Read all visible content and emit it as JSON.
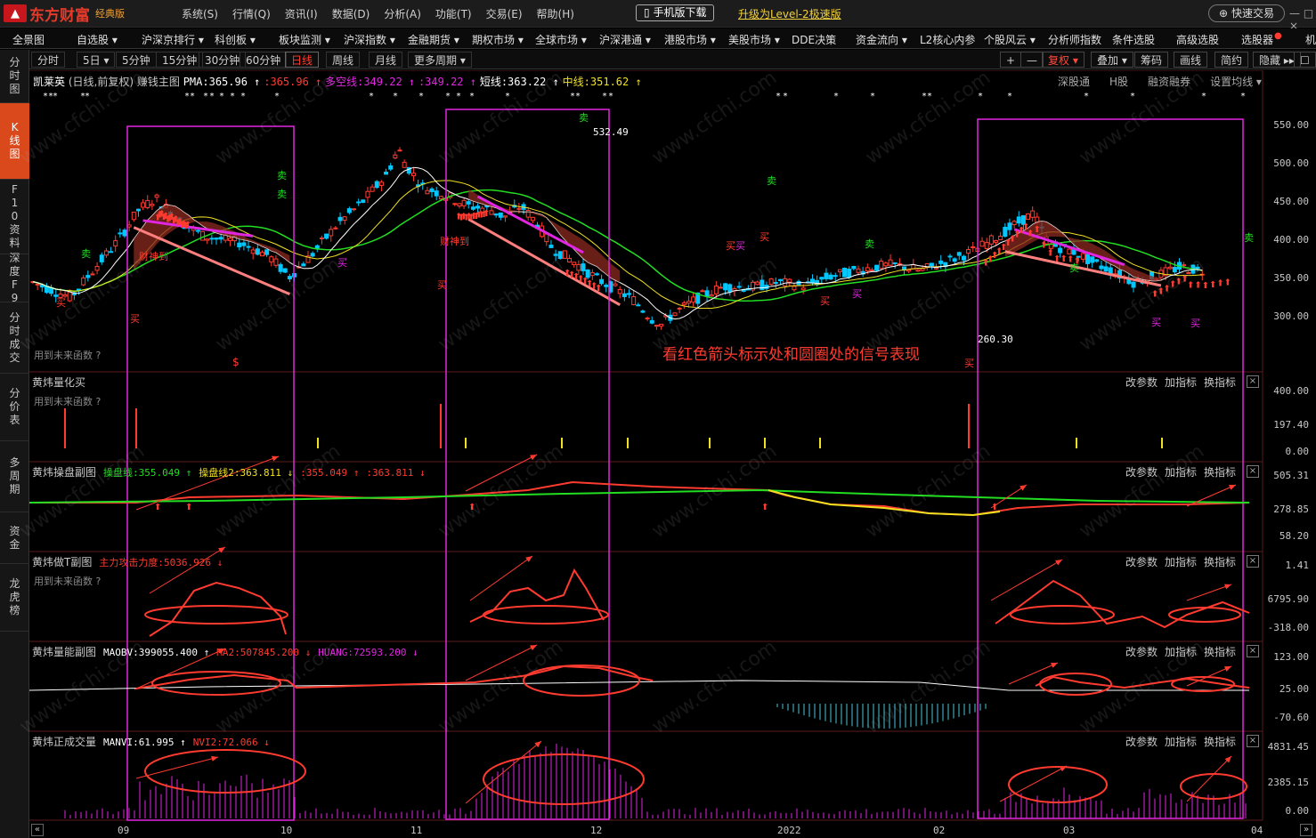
{
  "app": {
    "logo_mark": "东方",
    "logo_text": "东方财富",
    "logo_sub": "经典版",
    "menu": [
      "系统(S)",
      "行情(Q)",
      "资讯(I)",
      "数据(D)",
      "分析(A)",
      "功能(T)",
      "交易(E)",
      "帮助(H)"
    ],
    "mobile_download": "手机版下载",
    "upgrade": "升级为Level-2极速版",
    "quick_trade": "快速交易",
    "win_controls": "— □ ×"
  },
  "nav": [
    "全景图",
    "自选股 ▾",
    "沪深京排行 ▾",
    "科创板 ▾",
    "板块监测 ▾",
    "沪深指数 ▾",
    "金融期货 ▾",
    "期权市场 ▾",
    "全球市场 ▾",
    "沪深港通 ▾",
    "港股市场 ▾",
    "美股市场 ▾",
    "DDE决策",
    "资金流向 ▾",
    "L2核心内参",
    "个股风云 ▾",
    "分析师指数",
    "条件选股",
    "高级选股",
    "选股器",
    "机"
  ],
  "sidebar": [
    "分时图",
    "K线图",
    "F10资料",
    "深度F9",
    "分时成交",
    "分价表",
    "多周期",
    "资金",
    "龙虎榜"
  ],
  "periods": [
    "分时",
    "5日 ▾",
    "5分钟",
    "15分钟",
    "30分钟",
    "60分钟",
    "日线",
    "周线",
    "月线",
    "更多周期 ▾"
  ],
  "tools": [
    "+",
    "—",
    "复权 ▾",
    "叠加 ▾",
    "筹码",
    "画线",
    "简约",
    "隐藏 ▸▸",
    "☐"
  ],
  "main_panel": {
    "stock": "凯莱英",
    "desc": "(日线,前复权)",
    "indicator": "赚钱主图",
    "pma": "PMA:365.96 ↑",
    "pma2": ":365.96 ↑",
    "duokong": "多空线:349.22 ↑",
    "duokong2": ":349.22 ↑",
    "short_line": "短线:363.22 ↑",
    "mid_line": "中线:351.62 ↑",
    "right_tools": [
      "深股通",
      "H股",
      "融资融券",
      "设置均线 ▾"
    ],
    "y_ticks": [
      "550.00",
      "500.00",
      "450.00",
      "400.00",
      "350.00",
      "300.00"
    ],
    "high_label": "532.49",
    "low_label": "260.30",
    "future_note": "用到未来函数 ?",
    "annotation": "看红色箭头标示处和圆圈处的信号表现",
    "marks": {
      "buy": "买",
      "sell": "卖",
      "caishen": "财神到",
      "dollar": "$"
    }
  },
  "panels": [
    {
      "title": "黄炜量化买",
      "future_note": "用到未来函数 ?",
      "y_ticks": [
        "400.00",
        "197.40",
        "0.00"
      ]
    },
    {
      "title": "黄炜操盘副图",
      "line1": "操盘线:355.049 ↑",
      "line2": "操盘线2:363.811 ↓",
      "line3": ":355.049 ↑",
      "line4": ":363.811 ↓",
      "y_ticks": [
        "505.31",
        "278.85",
        "58.20"
      ]
    },
    {
      "title": "黄炜做T副图",
      "line1": "主力攻击力度:5036.926 ↓",
      "future_note": "用到未来函数 ?",
      "y_ticks": [
        "1.41",
        "6795.90",
        "-318.00"
      ]
    },
    {
      "title": "黄炜量能副图",
      "line1": "MAOBV:399055.400 ↑",
      "line2": "MA2:507845.200 ↓",
      "line3": "HUANG:72593.200 ↓",
      "y_ticks": [
        "123.00",
        "25.00",
        "-70.60"
      ]
    },
    {
      "title": "黄炜正成交量",
      "line1": "MANVI:61.995 ↑",
      "line2": "NVI2:72.066 ↓",
      "y_ticks": [
        "4831.45",
        "2385.15",
        "0.00"
      ]
    }
  ],
  "panel_tools": [
    "改参数",
    "加指标",
    "换指标"
  ],
  "x_labels": [
    "09",
    "10",
    "11",
    "12",
    "2022",
    "02",
    "03",
    "04"
  ],
  "watermark": "www.cfchi.com",
  "colors": {
    "up": "#ff3b30",
    "down": "#00c8ff",
    "magenta": "#e026e0",
    "green": "#22dd22",
    "yellow": "#f0e020",
    "accent": "#d9491c"
  }
}
